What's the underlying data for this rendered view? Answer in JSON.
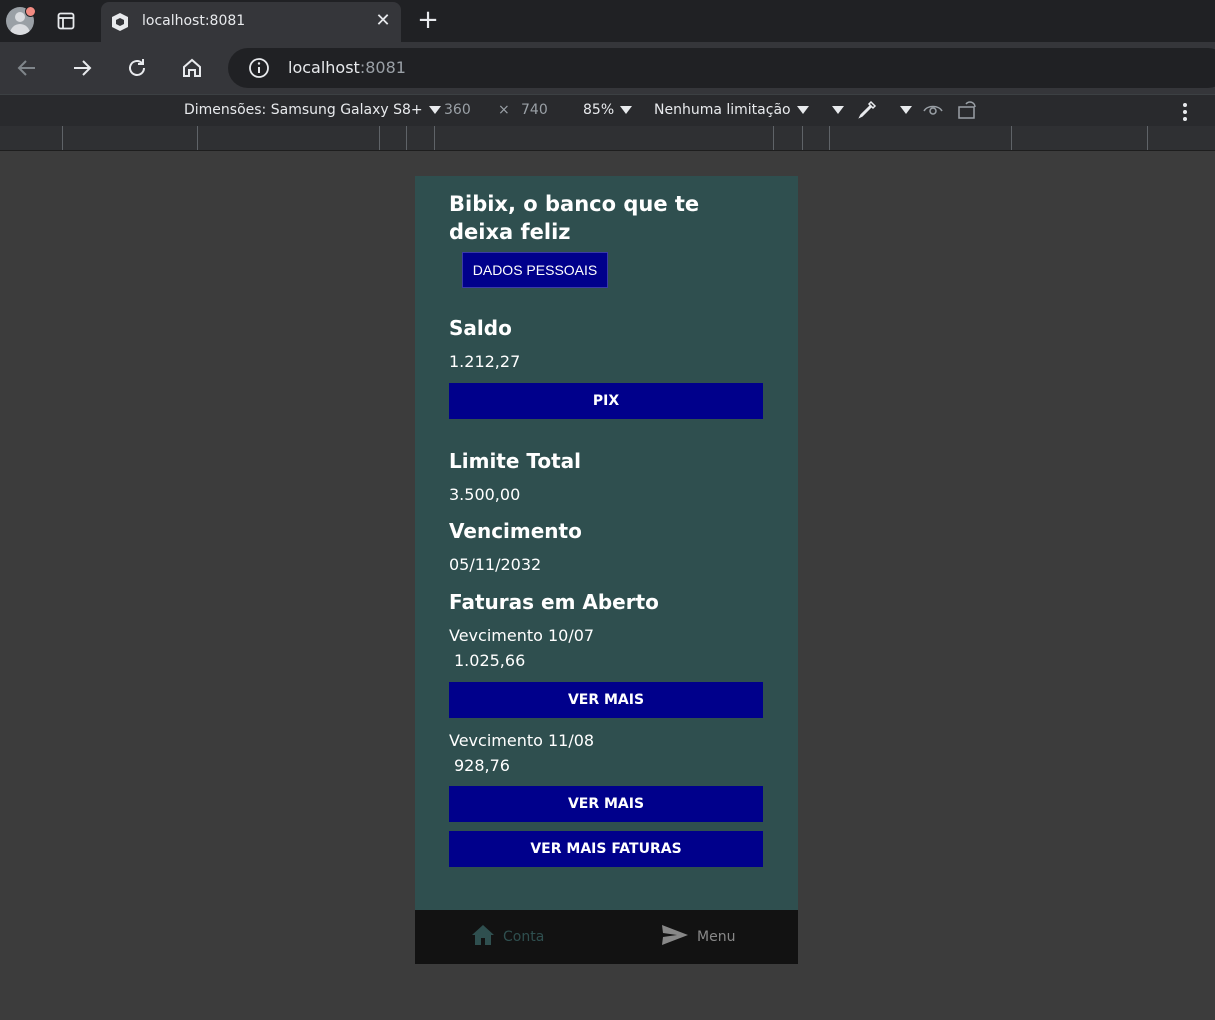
{
  "browser": {
    "tab_title": "localhost:8081",
    "url_host": "localhost",
    "url_port": ":8081"
  },
  "devtools": {
    "dimensions_label": "Dimensões: Samsung Galaxy S8+",
    "width": "360",
    "times": "×",
    "height": "740",
    "zoom": "85%",
    "throttling": "Nenhuma limitação"
  },
  "app": {
    "title": "Bibix, o banco que te deixa feliz",
    "dados_button": "DADOS PESSOAIS",
    "saldo": {
      "heading": "Saldo",
      "value": "1.212,27",
      "pix_button": "PIX"
    },
    "limite": {
      "heading": "Limite Total",
      "value": "3.500,00"
    },
    "vencimento": {
      "heading": "Vencimento",
      "value": "05/11/2032"
    },
    "faturas": {
      "heading": "Faturas em Aberto",
      "items": [
        {
          "due": "Vevcimento 10/07",
          "amount": "1.025,66",
          "button": "VER MAIS"
        },
        {
          "due": "Vevcimento 11/08",
          "amount": "928,76",
          "button": "VER MAIS"
        }
      ],
      "more_button": "VER MAIS FATURAS"
    },
    "bottom_tabs": [
      {
        "label": "Conta",
        "icon": "home-icon"
      },
      {
        "label": "Menu",
        "icon": "send-icon"
      }
    ]
  },
  "colors": {
    "app_bg": "#2f4f4f",
    "button_bg": "#00008b",
    "tab_active": "#2f4f4f",
    "tab_inactive": "#888888"
  }
}
